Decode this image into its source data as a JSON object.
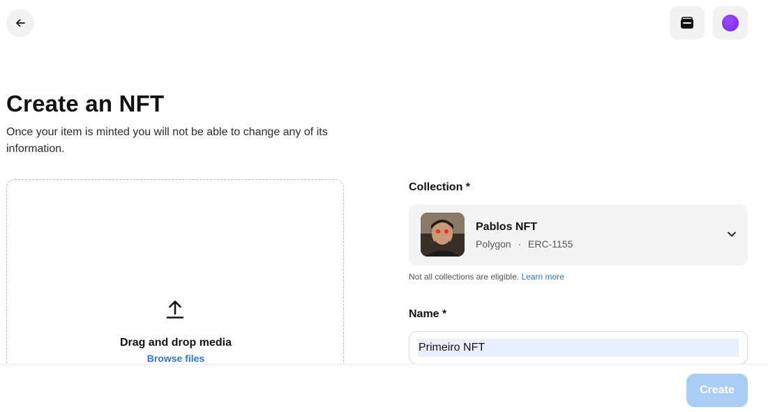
{
  "header": {
    "back_icon": "arrow-left-icon",
    "wallet_icon": "wallet-icon",
    "profile_color": "#8a34f0"
  },
  "page": {
    "title": "Create an NFT",
    "subtitle": "Once your item is minted you will not be able to change any of its information."
  },
  "upload": {
    "icon": "upload-icon",
    "title": "Drag and drop media",
    "browse_label": "Browse files"
  },
  "collection": {
    "label": "Collection *",
    "name": "Pablos NFT",
    "chain": "Polygon",
    "separator": "·",
    "standard": "ERC-1155",
    "note": "Not all collections are eligible.",
    "learn_more": "Learn more"
  },
  "name_field": {
    "label": "Name *",
    "value": "Primeiro NFT"
  },
  "footer": {
    "create_label": "Create",
    "accent": "#a9cdf4"
  }
}
